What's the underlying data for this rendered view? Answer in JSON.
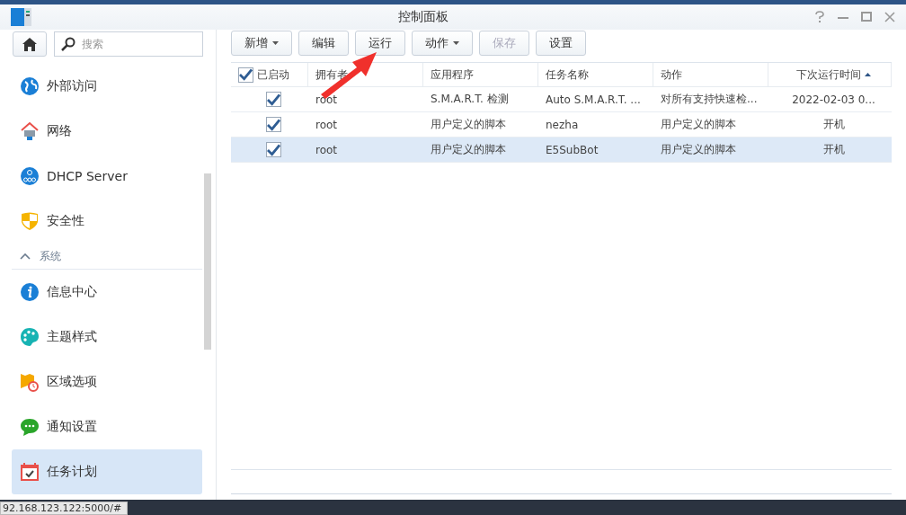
{
  "window": {
    "title": "控制面板"
  },
  "search": {
    "placeholder": "搜索"
  },
  "sidebar": {
    "items": [
      {
        "kind": "item",
        "label": "外部访问",
        "selected": false
      },
      {
        "kind": "item",
        "label": "网络",
        "selected": false
      },
      {
        "kind": "item",
        "label": "DHCP Server",
        "selected": false
      },
      {
        "kind": "item",
        "label": "安全性",
        "selected": false
      },
      {
        "kind": "section",
        "label": "系统",
        "expanded": true
      },
      {
        "kind": "item",
        "label": "信息中心",
        "selected": false
      },
      {
        "kind": "item",
        "label": "主题样式",
        "selected": false
      },
      {
        "kind": "item",
        "label": "区域选项",
        "selected": false
      },
      {
        "kind": "item",
        "label": "通知设置",
        "selected": false
      },
      {
        "kind": "item",
        "label": "任务计划",
        "selected": true
      }
    ]
  },
  "toolbar": [
    {
      "label": "新增",
      "dropdown": true,
      "disabled": false
    },
    {
      "label": "编辑",
      "dropdown": false,
      "disabled": false
    },
    {
      "label": "运行",
      "dropdown": false,
      "disabled": false
    },
    {
      "label": "动作",
      "dropdown": true,
      "disabled": false
    },
    {
      "label": "保存",
      "dropdown": false,
      "disabled": true
    },
    {
      "label": "设置",
      "dropdown": false,
      "disabled": false
    }
  ],
  "table": {
    "header_checked": true,
    "columns": [
      {
        "label": "已启动",
        "sorted": false
      },
      {
        "label": "拥有者",
        "sorted": false
      },
      {
        "label": "应用程序",
        "sorted": false
      },
      {
        "label": "任务名称",
        "sorted": false
      },
      {
        "label": "动作",
        "sorted": false
      },
      {
        "label": "下次运行时间",
        "sorted": true
      }
    ],
    "rows": [
      {
        "enabled": true,
        "selected": false,
        "owner": "root",
        "application": "S.M.A.R.T. 检测",
        "task_name": "Auto S.M.A.R.T. ...",
        "action": "对所有支持快速检...",
        "next_run": "2022-02-03 0..."
      },
      {
        "enabled": true,
        "selected": false,
        "owner": "root",
        "application": "用户定义的脚本",
        "task_name": "nezha",
        "action": "用户定义的脚本",
        "next_run": "开机"
      },
      {
        "enabled": true,
        "selected": true,
        "owner": "root",
        "application": "用户定义的脚本",
        "task_name": "E5SubBot",
        "action": "用户定义的脚本",
        "next_run": "开机"
      }
    ]
  },
  "status_url": "92.168.123.122:5000/#"
}
